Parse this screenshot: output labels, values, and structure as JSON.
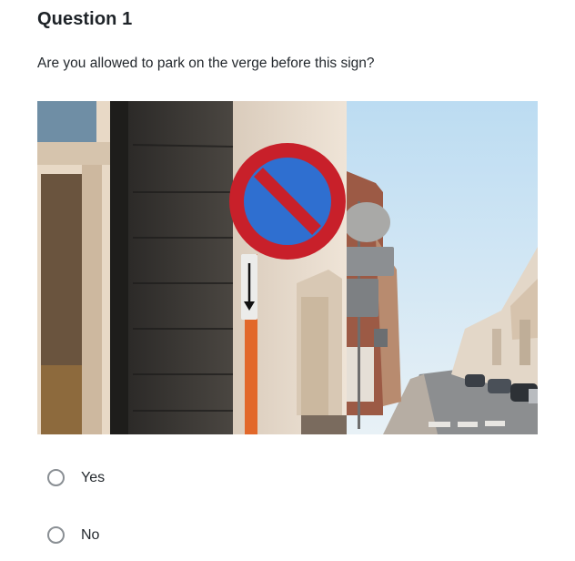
{
  "question": {
    "title": "Question 1",
    "text": "Are you allowed to park on the verge before this sign?"
  },
  "image": {
    "subject": "no-parking-sign",
    "colors": {
      "sign_red": "#c8202a",
      "sign_blue": "#2f6fd0",
      "sky": "#cfe6f5",
      "pole_orange": "#e2682a"
    }
  },
  "options": [
    {
      "label": "Yes"
    },
    {
      "label": "No"
    }
  ]
}
